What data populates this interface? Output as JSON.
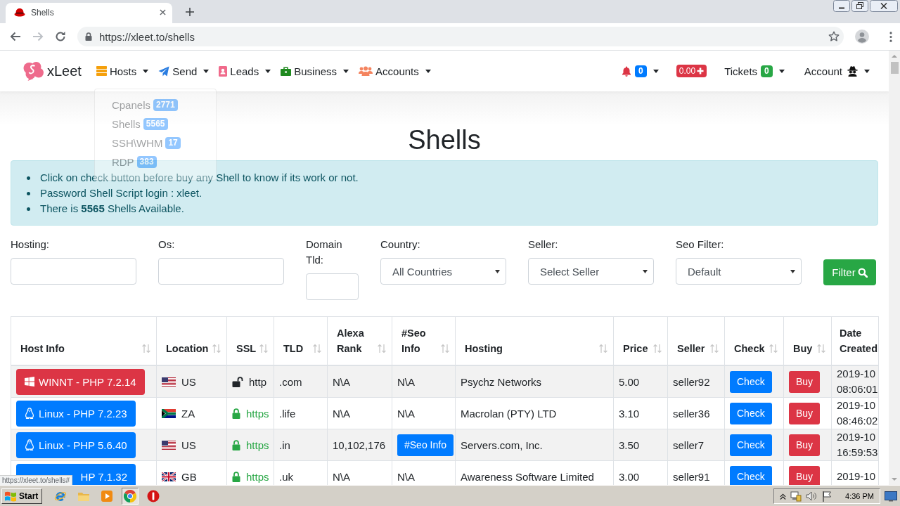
{
  "browser": {
    "tab": {
      "title": "Shells"
    },
    "url": "https://xleet.to/shells",
    "status_url": "https://xleet.to/shells#"
  },
  "navbar": {
    "brand": "xLeet",
    "menus": [
      {
        "label": "Hosts",
        "items": [
          {
            "label": "Cpanels",
            "count": "2771"
          },
          {
            "label": "Shells",
            "count": "5565"
          },
          {
            "label": "SSH\\WHM",
            "count": "17"
          },
          {
            "label": "RDP",
            "count": "383"
          }
        ]
      },
      {
        "label": "Send"
      },
      {
        "label": "Leads"
      },
      {
        "label": "Business"
      },
      {
        "label": "Accounts"
      }
    ],
    "notifications": {
      "count": "0"
    },
    "balance": "0.00",
    "tickets": {
      "label": "Tickets",
      "count": "0"
    },
    "account": {
      "label": "Account"
    }
  },
  "page": {
    "title": "Shells",
    "notices": [
      "Click on check button before buy any Shell to know if its work or not.",
      "Password Shell Script login : xleet.",
      "There is **5565** Shells Available."
    ]
  },
  "filters": {
    "fields": [
      {
        "label": "Hosting:",
        "kind": "input"
      },
      {
        "label": "Os:",
        "kind": "input"
      },
      {
        "label": "Domain Tld:",
        "kind": "input"
      },
      {
        "label": "Country:",
        "kind": "select",
        "value": "All Countries"
      },
      {
        "label": "Seller:",
        "kind": "select",
        "value": "Select Seller"
      },
      {
        "label": "Seo Filter:",
        "kind": "select",
        "value": "Default"
      }
    ],
    "button": "Filter"
  },
  "table": {
    "columns": [
      {
        "label": "Host Info",
        "sortable": true
      },
      {
        "label": "Location",
        "sortable": true
      },
      {
        "label": "SSL",
        "sortable": true
      },
      {
        "label": "TLD",
        "sortable": true
      },
      {
        "label": "Alexa Rank",
        "sortable": true
      },
      {
        "label": "#Seo Info",
        "sortable": true
      },
      {
        "label": "Hosting",
        "sortable": true
      },
      {
        "label": "Price",
        "sortable": true
      },
      {
        "label": "Seller",
        "sortable": true
      },
      {
        "label": "Check",
        "sortable": true
      },
      {
        "label": "Buy",
        "sortable": true
      },
      {
        "label": "Date Created",
        "sortable": false
      }
    ],
    "rows": [
      {
        "host": {
          "kind": "windows",
          "label": "WINNT - PHP 7.2.14",
          "clipped": false
        },
        "location": {
          "kind": "us",
          "code": "US"
        },
        "ssl": {
          "secure": false,
          "label": "http"
        },
        "tld": ".com",
        "alexa_rank": "N\\A",
        "seo_info": {
          "kind": "text",
          "label": "N\\A"
        },
        "hosting": "Psychz Networks",
        "price": "5.00",
        "seller": "seller92",
        "check": "Check",
        "buy": "Buy",
        "date": "2019-10",
        "time": "08:06:01"
      },
      {
        "host": {
          "kind": "linux",
          "label": "Linux - PHP 7.2.23",
          "clipped": false
        },
        "location": {
          "kind": "za",
          "code": "ZA"
        },
        "ssl": {
          "secure": true,
          "label": "https"
        },
        "tld": ".life",
        "alexa_rank": "N\\A",
        "seo_info": {
          "kind": "text",
          "label": "N\\A"
        },
        "hosting": "Macrolan (PTY) LTD",
        "price": "3.10",
        "seller": "seller36",
        "check": "Check",
        "buy": "Buy",
        "date": "2019-10",
        "time": "08:46:02"
      },
      {
        "host": {
          "kind": "linux",
          "label": "Linux - PHP 5.6.40",
          "clipped": false
        },
        "location": {
          "kind": "us",
          "code": "US"
        },
        "ssl": {
          "secure": true,
          "label": "https"
        },
        "tld": ".in",
        "alexa_rank": "10,102,176",
        "seo_info": {
          "kind": "button",
          "label": "#Seo Info"
        },
        "hosting": "Servers.com, Inc.",
        "price": "3.50",
        "seller": "seller7",
        "check": "Check",
        "buy": "Buy",
        "date": "2019-10",
        "time": "16:59:53"
      },
      {
        "host": {
          "kind": "linux",
          "label": "HP 7.1.32",
          "clipped": true
        },
        "location": {
          "kind": "gb",
          "code": "GB"
        },
        "ssl": {
          "secure": true,
          "label": "https"
        },
        "tld": ".uk",
        "alexa_rank": "N\\A",
        "seo_info": {
          "kind": "text",
          "label": "N\\A"
        },
        "hosting": "Awareness Software Limited",
        "price": "3.00",
        "seller": "seller91",
        "check": "Check",
        "buy": "Buy",
        "date": "2019-10"
      }
    ]
  },
  "taskbar": {
    "start": "Start",
    "quick_launch": [
      {
        "selected": false
      },
      {
        "selected": false
      },
      {
        "selected": false
      },
      {
        "selected": true
      },
      {
        "selected": false
      }
    ],
    "clock": "4:36 PM"
  }
}
